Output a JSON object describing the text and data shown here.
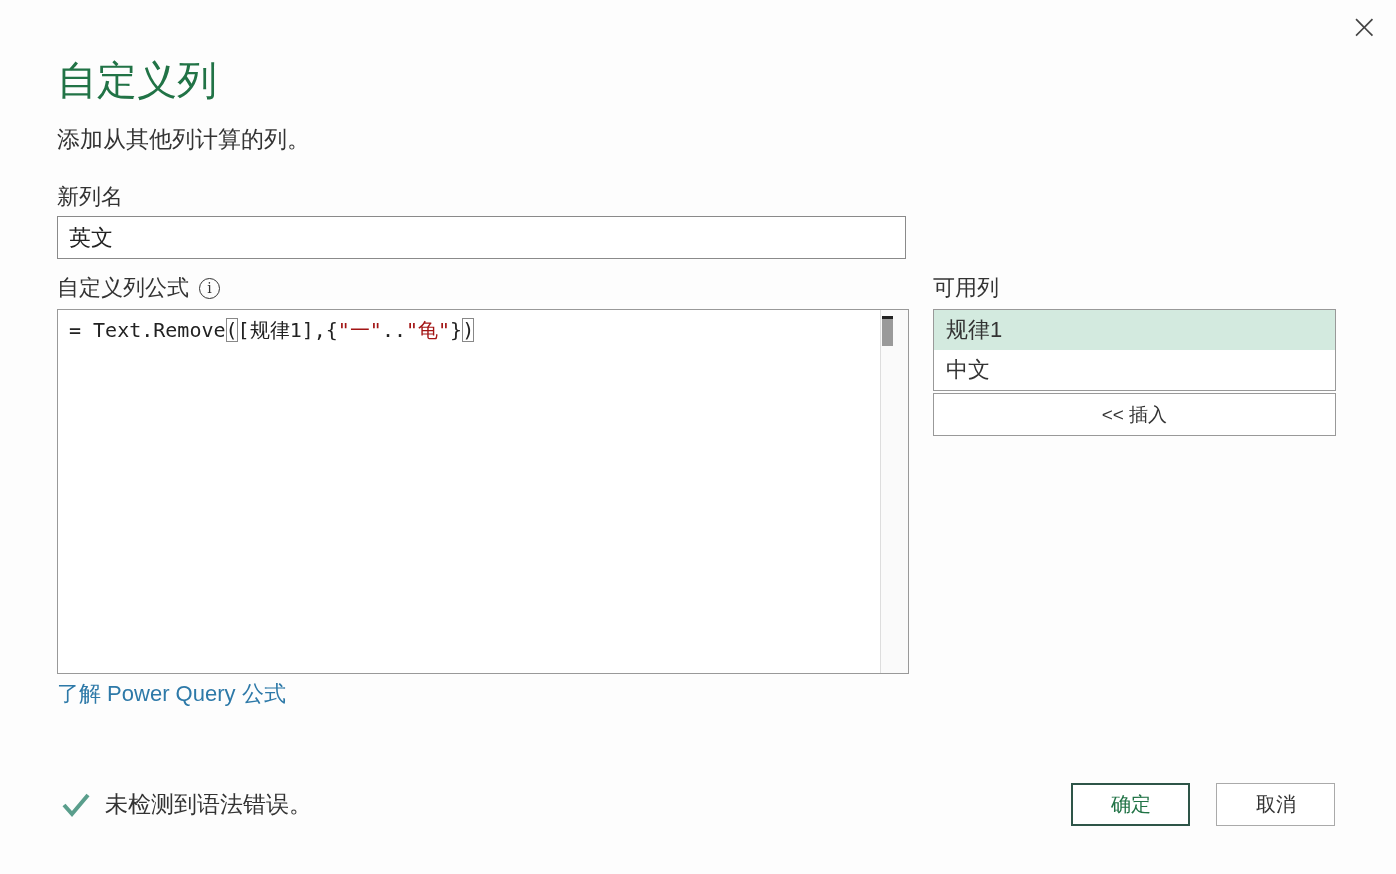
{
  "window": {
    "title": "自定义列",
    "close_icon": "×"
  },
  "description": "添加从其他列计算的列。",
  "new_column_name": {
    "label": "新列名",
    "value": "英文"
  },
  "formula": {
    "label": "自定义列公式",
    "info_icon": "i",
    "tokens": [
      {
        "kind": "code",
        "text": "= Text.Remove"
      },
      {
        "kind": "brace",
        "text": "("
      },
      {
        "kind": "code",
        "text": "[规律1],{"
      },
      {
        "kind": "string",
        "text": "\"一\""
      },
      {
        "kind": "code",
        "text": ".."
      },
      {
        "kind": "string",
        "text": "\"龟\""
      },
      {
        "kind": "code",
        "text": "}"
      },
      {
        "kind": "brace",
        "text": ")"
      }
    ]
  },
  "available_columns": {
    "label": "可用列",
    "items": [
      {
        "label": "规律1",
        "selected": true
      },
      {
        "label": "中文",
        "selected": false
      }
    ],
    "insert_button": "<< 插入"
  },
  "learn_link": "了解 Power Query 公式",
  "status": {
    "ok": true,
    "text": "未检测到语法错误。"
  },
  "buttons": [
    {
      "label": "确定",
      "primary": true
    },
    {
      "label": "取消",
      "primary": false
    }
  ]
}
